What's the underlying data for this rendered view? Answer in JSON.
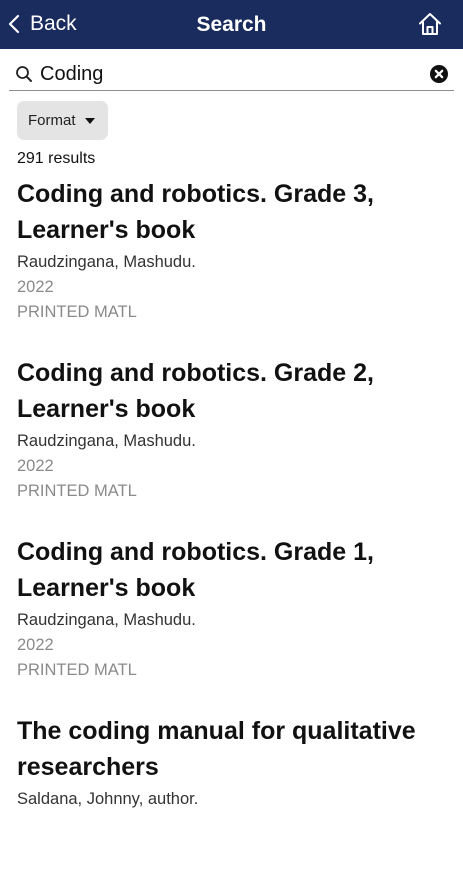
{
  "header": {
    "back_label": "Back",
    "title": "Search",
    "home_icon": "home-icon",
    "back_icon": "chevron-left-icon",
    "background_color": "#1a2b5e"
  },
  "search": {
    "value": "Coding",
    "search_icon": "search-icon",
    "clear_icon": "clear-icon"
  },
  "filters": {
    "format_label": "Format"
  },
  "results_count": "291 results",
  "results": [
    {
      "title": "Coding and robotics. Grade 3, Learner's book",
      "author": "Raudzingana, Mashudu.",
      "year": "2022",
      "format": "PRINTED MATL"
    },
    {
      "title": "Coding and robotics. Grade 2, Learner's book",
      "author": "Raudzingana, Mashudu.",
      "year": "2022",
      "format": "PRINTED MATL"
    },
    {
      "title": "Coding and robotics. Grade 1, Learner's book",
      "author": "Raudzingana, Mashudu.",
      "year": "2022",
      "format": "PRINTED MATL"
    },
    {
      "title": "The coding manual for qualitative researchers",
      "author": "Saldana, Johnny, author.",
      "year": "",
      "format": ""
    }
  ]
}
